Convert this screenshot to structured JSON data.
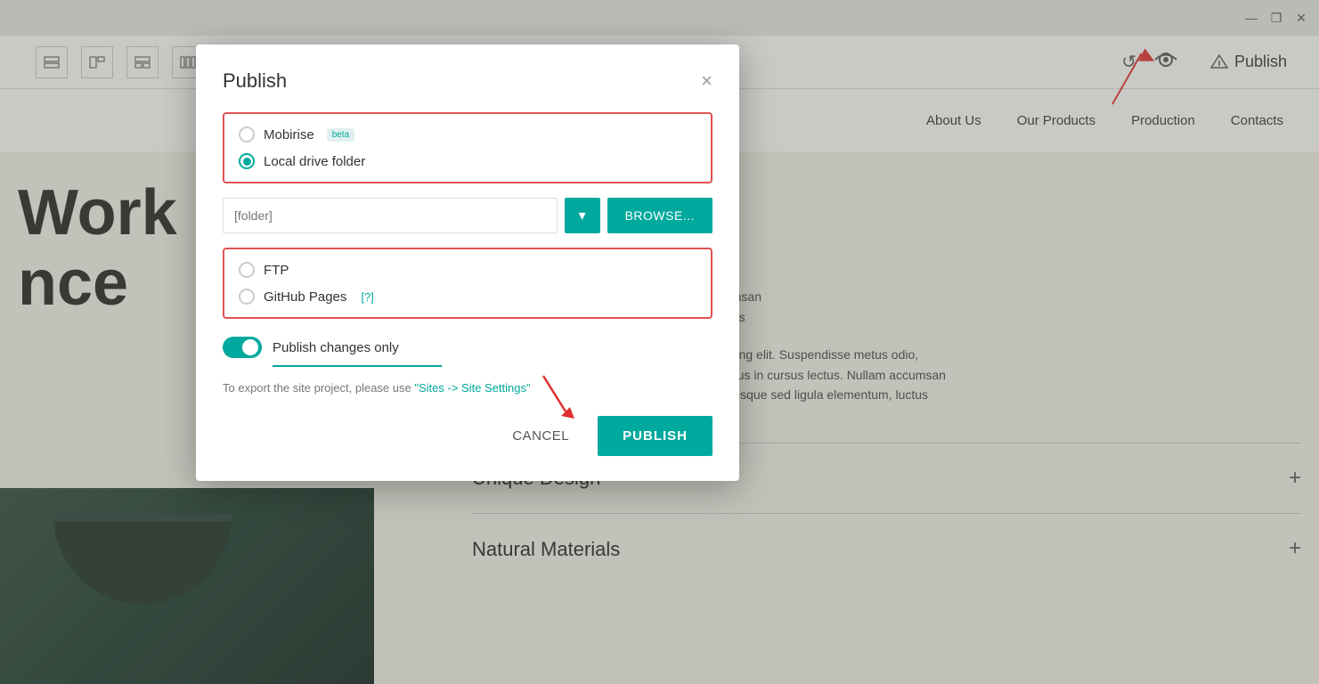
{
  "titlebar": {
    "minimize": "—",
    "maximize": "❐",
    "close": "✕"
  },
  "toolbar": {
    "publish_label": "Publish",
    "undo_icon": "↺",
    "preview_icon": "👁"
  },
  "nav": {
    "items": [
      "About Us",
      "Our Products",
      "Production",
      "Contacts"
    ]
  },
  "hero": {
    "line1": "Work",
    "line2": "nce"
  },
  "content": {
    "paragraphs": [
      "ctetur adipiscing elit. Suspendisse metus odio,\na lacus. Vivamus in cursus lectus. Nullam accumsan\nstie at. Pellentesque sed ligula elementum, luctus",
      "Lorem ipsum dolor sit amet, consectetur adipiscing elit. Suspendisse metus odio,\nsemper in mi eget, tempus gravida lacus. Vivamus in cursus lectus. Nullam accumsan\nturpis erat, nec mollis purus molestie at. Pellentesque sed ligula elementum, luctus\nquam ut, feugiat libero."
    ],
    "accordion": [
      "Unique Design",
      "Natural Materials"
    ]
  },
  "dialog": {
    "title": "Publish",
    "close_label": "×",
    "options": {
      "group1": [
        {
          "id": "mobirise",
          "label": "Mobirise",
          "badge": "beta",
          "checked": false
        },
        {
          "id": "local",
          "label": "Local drive folder",
          "badge": "",
          "checked": true
        }
      ],
      "group2": [
        {
          "id": "ftp",
          "label": "FTP",
          "checked": false
        },
        {
          "id": "github",
          "label": "GitHub Pages",
          "help": "[?]",
          "checked": false
        }
      ]
    },
    "folder_placeholder": "[folder]",
    "dropdown_icon": "▾",
    "browse_label": "BROWSE...",
    "toggle": {
      "label": "Publish changes only",
      "enabled": true
    },
    "export_note": "To export the site project, please use ",
    "export_link": "\"Sites -> Site Settings\"",
    "cancel_label": "CANCEL",
    "publish_label": "PUBLISH"
  }
}
